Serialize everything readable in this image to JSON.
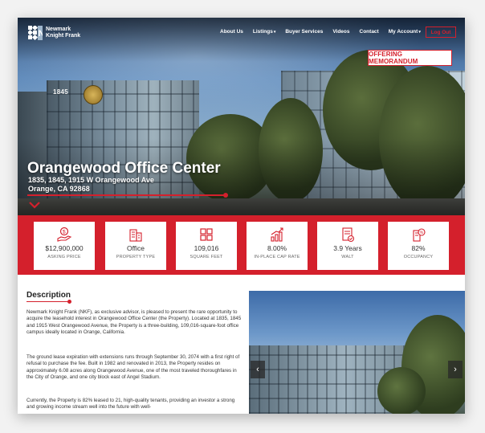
{
  "brand": {
    "line1": "Newmark",
    "line2": "Knight Frank"
  },
  "nav": {
    "items": [
      {
        "label": "About Us",
        "dropdown": false
      },
      {
        "label": "Listings",
        "dropdown": true
      },
      {
        "label": "Buyer Services",
        "dropdown": false
      },
      {
        "label": "Videos",
        "dropdown": false
      },
      {
        "label": "Contact",
        "dropdown": false
      },
      {
        "label": "My Account",
        "dropdown": true
      }
    ],
    "logout": "Log Out"
  },
  "hero": {
    "cta": "OFFERING MEMORANDUM",
    "title": "Orangewood Office Center",
    "address_line1": "1835, 1845, 1915 W Orangewood Ave",
    "address_line2": "Orange, CA 92868",
    "building_number": "1845"
  },
  "stats": [
    {
      "icon": "money-hand-icon",
      "value": "$12,900,000",
      "label": "ASKING PRICE"
    },
    {
      "icon": "office-building-icon",
      "value": "Office",
      "label": "PROPERTY TYPE"
    },
    {
      "icon": "grid-icon",
      "value": "109,016",
      "label": "SQUARE FEET"
    },
    {
      "icon": "growth-chart-icon",
      "value": "8.00%",
      "label": "IN-PLACE CAP RATE"
    },
    {
      "icon": "document-check-icon",
      "value": "3.9 Years",
      "label": "WALT"
    },
    {
      "icon": "building-percent-icon",
      "value": "82%",
      "label": "OCCUPANCY"
    }
  ],
  "description": {
    "heading": "Description",
    "paragraphs": [
      "Newmark Knight Frank (NKF), as exclusive advisor, is pleased to present the rare opportunity to acquire the leasehold interest in Orangewood Office Center (the Property). Located at 1835, 1845 and 1915 West Orangewood Avenue, the Property is a three-building, 109,016-square-foot office campus ideally located in Orange, California.",
      "The ground lease expiration with extensions runs through September 30, 2074 with a first right of refusal to purchase the fee. Built in 1982 and renovated in 2013, the Property resides on approximately 6.08 acres along Orangewood Avenue, one of the most traveled thoroughfares in the City of Orange, and one city block east of Angel Stadium.",
      "Currently, the Property is 82% leased to 21, high-quality tenants, providing an investor a strong and growing income stream well into the future with well-"
    ]
  },
  "colors": {
    "accent": "#d4202c",
    "text": "#333333"
  }
}
